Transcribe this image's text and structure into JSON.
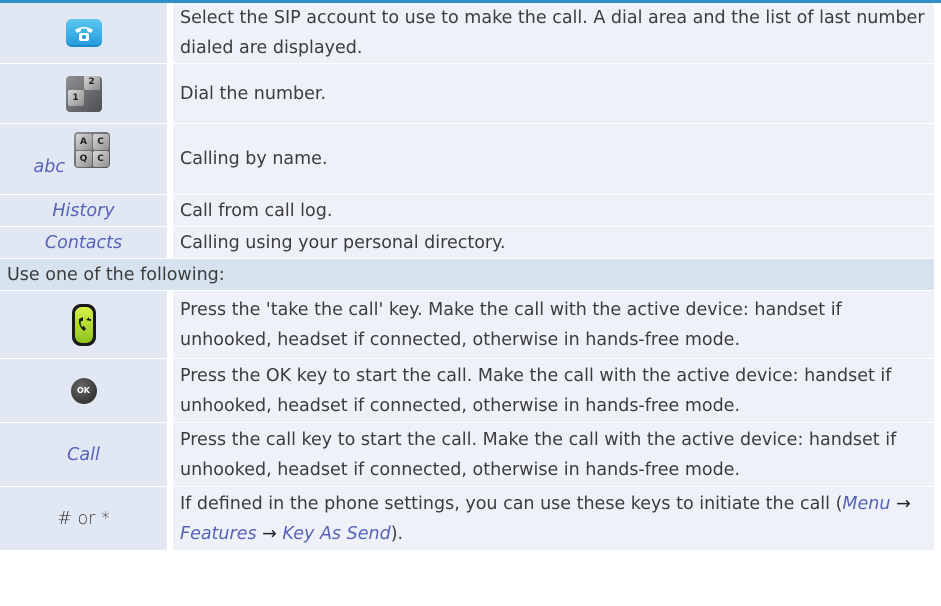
{
  "rows": [
    {
      "key_icon": "phone-app-icon",
      "desc": "Select the SIP account to use to make the call. A dial area and the list of last number dialed are displayed."
    },
    {
      "key_icon": "keypad-icon",
      "desc": "Dial the number."
    },
    {
      "key_label": "abc",
      "key_icon": "alpha-keypad-icon",
      "desc": "Calling by name."
    },
    {
      "key_label": "History",
      "desc": "Call from call log."
    },
    {
      "key_label": "Contacts",
      "desc": "Calling using your personal directory."
    }
  ],
  "section": "Use one of the following:",
  "rows2": [
    {
      "key_icon": "take-call-key-icon",
      "desc": "Press the 'take the call' key. Make the call with the active device: handset if unhooked, headset if connected, otherwise in hands-free mode."
    },
    {
      "key_icon": "ok-key-icon",
      "ok_text": "OK",
      "desc": "Press the OK key to start the call. Make the call with the active device: handset if unhooked, headset if connected, otherwise in hands-free mode."
    },
    {
      "key_label": "Call",
      "desc": "Press the call key to start the call. Make the call with the active device: handset if unhooked, headset if connected, otherwise in hands-free mode."
    },
    {
      "key_label": "# or *",
      "desc_start": "If defined in the phone settings, you can use these keys to initiate the call (",
      "menu": "Menu",
      "arrow": "→",
      "features": "Features",
      "key_as_send": "Key As Send",
      "desc_end": ")."
    }
  ],
  "colors": {
    "accent_rule": "#2f8fc6",
    "key_cell": "#e1e8f3",
    "desc_cell": "#eef2f8",
    "section_cell": "#d6e3ef",
    "link_text": "#5562b8"
  }
}
